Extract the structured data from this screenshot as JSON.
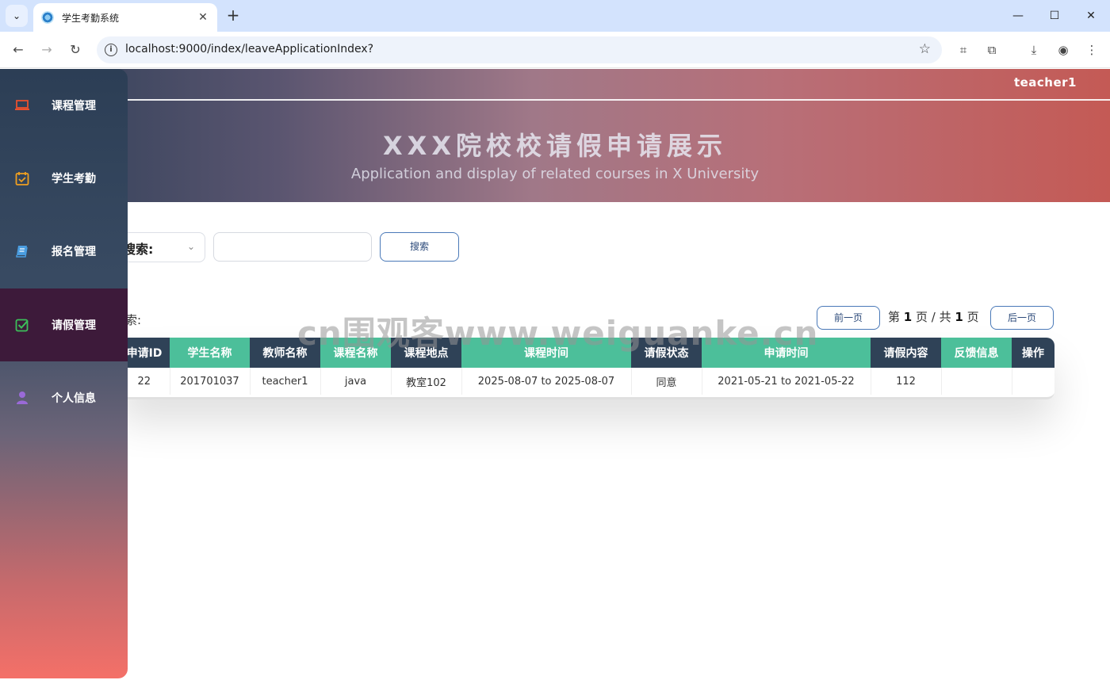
{
  "browser": {
    "tab_title": "学生考勤系统",
    "url": "localhost:9000/index/leaveApplicationIndex?"
  },
  "header": {
    "user": "teacher1",
    "title": "XXX院校校请假申请展示",
    "subtitle": "Application and display of related courses in X University"
  },
  "sidebar": {
    "items": [
      {
        "label": "课程管理",
        "icon": "laptop-icon"
      },
      {
        "label": "学生考勤",
        "icon": "calendar-check-icon"
      },
      {
        "label": "报名管理",
        "icon": "book-icon"
      },
      {
        "label": "请假管理",
        "icon": "checkbox-icon"
      },
      {
        "label": "个人信息",
        "icon": "user-icon"
      }
    ]
  },
  "search": {
    "label": "搜索:",
    "button": "搜索",
    "input_value": ""
  },
  "results": {
    "label": "索:",
    "prev": "前一页",
    "next": "后一页",
    "page_prefix": "第",
    "page_current": "1",
    "page_mid": "页 / 共",
    "page_total": "1",
    "page_suffix": "页"
  },
  "table": {
    "headers": [
      "申请ID",
      "学生名称",
      "教师名称",
      "课程名称",
      "课程地点",
      "课程时间",
      "请假状态",
      "申请时间",
      "请假内容",
      "反馈信息",
      "操作"
    ],
    "rows": [
      [
        "22",
        "201701037",
        "teacher1",
        "java",
        "教室102",
        "2025-08-07 to 2025-08-07",
        "同意",
        "2021-05-21 to 2021-05-22",
        "112",
        "",
        ""
      ]
    ]
  },
  "watermark": "cn围观客www.weiguanke.cn"
}
